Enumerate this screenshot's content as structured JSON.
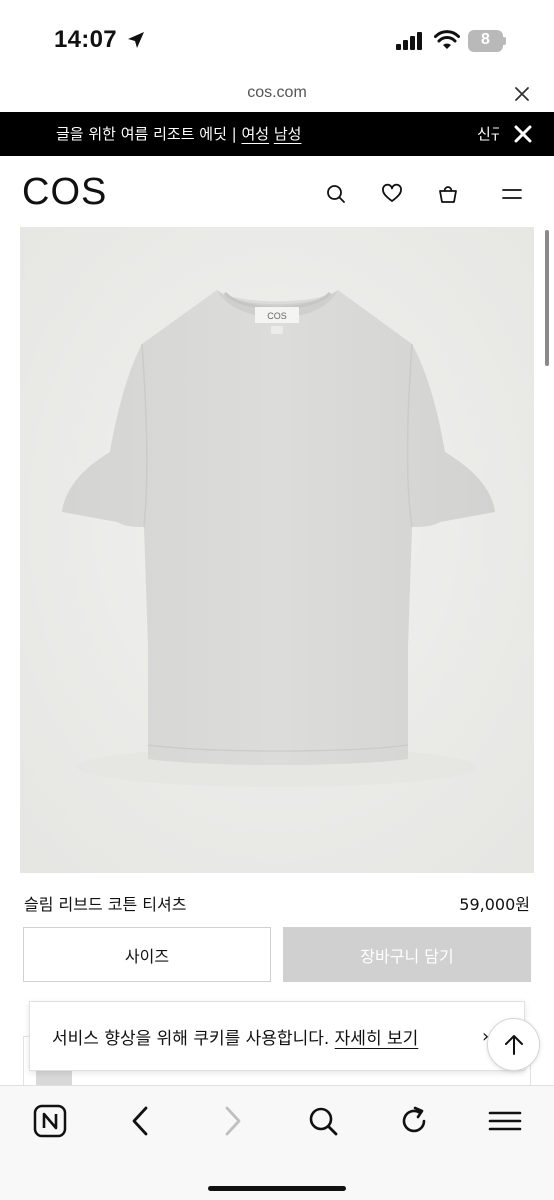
{
  "status_bar": {
    "time": "14:07",
    "battery": "8"
  },
  "browser": {
    "url": "cos.com"
  },
  "promo": {
    "text_prefix": "글을 위한 여름 리조트 에딧 | ",
    "link_women": "여성",
    "link_men": "남성",
    "next_text": "신규"
  },
  "header": {
    "logo": "COS"
  },
  "product": {
    "name": "슬림 리브드 코튼 티셔츠",
    "price": "59,000원",
    "size_button": "사이즈",
    "cart_button": "장바구니 담기",
    "tag_label": "COS"
  },
  "cookie_banner": {
    "message": "서비스 향상을 위해 쿠키를 사용합니다. ",
    "link": "자세히 보기",
    "chevron": "›"
  },
  "colors": {
    "cart_button_bg": "#d0d0d0",
    "promo_bg": "#000000",
    "image_bg": "#eeeeec",
    "shirt": "#d9d9d8"
  },
  "icons": [
    "location-arrow-icon",
    "signal-icon",
    "wifi-icon",
    "battery-icon",
    "close-icon",
    "search-icon",
    "heart-icon",
    "bag-icon",
    "menu-icon",
    "arrow-up-icon",
    "naver-icon",
    "back-icon",
    "forward-icon",
    "reload-icon"
  ]
}
